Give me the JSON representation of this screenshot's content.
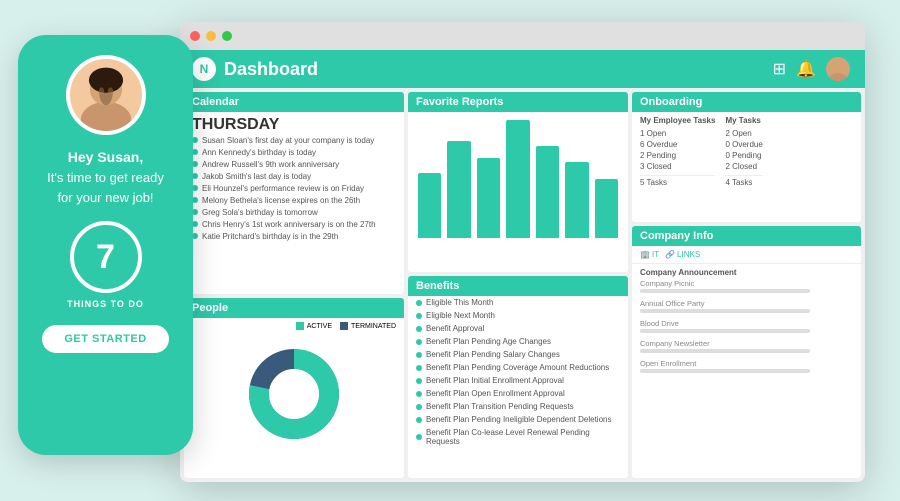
{
  "scene": {
    "background_color": "#d8f0ec"
  },
  "phone": {
    "background_color": "#2dc9a8",
    "greeting_line1": "Hey Susan,",
    "greeting_line2": "It's time to get ready",
    "greeting_line3": "for your new job!",
    "badge_number": "7",
    "things_label": "THINGS TO DO",
    "cta_button": "GET STARTED"
  },
  "browser": {
    "titlebar_dots": [
      "red",
      "yellow",
      "green"
    ],
    "topbar": {
      "logo_letter": "N",
      "title": "Dashboard",
      "icons": [
        "grid",
        "bell"
      ],
      "accent_color": "#2dc9a8"
    }
  },
  "calendar": {
    "header": "Calendar",
    "day": "THURSDAY",
    "events": [
      "Susan Sloan's first day at your company is today",
      "Ann Kennedy's birthday is today",
      "Andrew Russell's 9th work anniversary",
      "Jakob Smith's last day is today",
      "Eli Hounzel's performance review is on Friday",
      "Melony Bethela's license expires on the 26th",
      "Greg Sola's birthday is tomorrow",
      "Chris Henry's 1st work anniversary is on the 27th",
      "Katie Pritchard's birthday is in the 29th"
    ]
  },
  "people": {
    "header": "People",
    "legend": {
      "active_label": "ACTIVE",
      "terminated_label": "TERMINATED"
    },
    "chart": {
      "active_percent": 78,
      "terminated_percent": 22
    }
  },
  "favorite_reports": {
    "header": "Favorite Reports",
    "bars": [
      60,
      90,
      75,
      110,
      85,
      70,
      55
    ]
  },
  "benefits": {
    "header": "Benefits",
    "items": [
      "Eligible This Month",
      "Eligible Next Month",
      "Benefit Approval",
      "Benefit Plan Pending Age Changes",
      "Benefit Plan Pending Salary Changes",
      "Benefit Plan Pending Coverage Amount Reductions",
      "Benefit Plan Initial Enrollment Approval",
      "Benefit Plan Open Enrollment Approval",
      "Benefit Plan Transition Pending Requests",
      "Benefit Plan Pending Ineligible Dependent Deletions",
      "Benefit Plan Co-lease Level Renewal Pending Requests"
    ]
  },
  "onboarding": {
    "header": "Onboarding",
    "my_employee_tasks": {
      "title": "My Employee Tasks",
      "stats": [
        {
          "label": "1 Open"
        },
        {
          "label": "6 Overdue"
        },
        {
          "label": "2 Pending"
        },
        {
          "label": "3 Closed"
        },
        {
          "label": "5 Tasks"
        }
      ]
    },
    "my_tasks": {
      "title": "My Tasks",
      "stats": [
        {
          "label": "2 Open"
        },
        {
          "label": "0 Overdue"
        },
        {
          "label": "0 Pending"
        },
        {
          "label": "2 Closed"
        },
        {
          "label": "4 Tasks"
        }
      ]
    }
  },
  "company_info": {
    "header": "Company Info",
    "tabs": [
      "IT",
      "LINKS"
    ],
    "announcements_title": "Company Announcement",
    "items": [
      {
        "title": "Company Picnic",
        "bar": true
      },
      {
        "title": "Annual Office Party",
        "bar": true
      },
      {
        "title": "Blood Drive",
        "bar": true
      },
      {
        "title": "Company Newsletter",
        "bar": true
      },
      {
        "title": "Open Enrollment",
        "bar": true
      }
    ]
  }
}
